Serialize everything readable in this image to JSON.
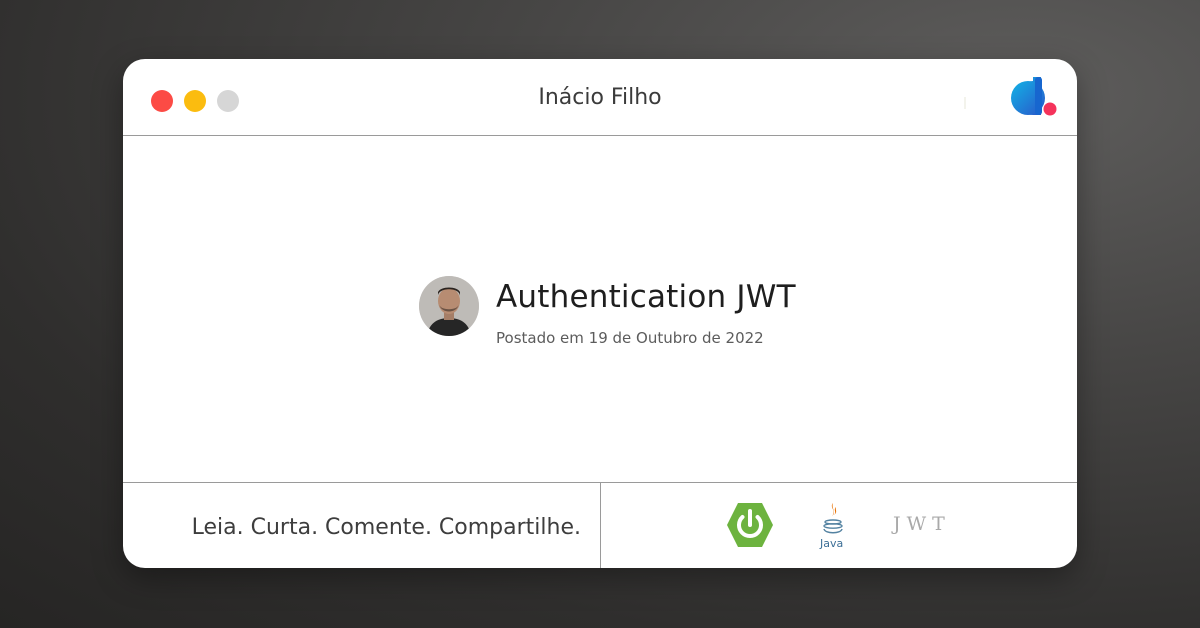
{
  "window": {
    "title": "Inácio Filho",
    "controls": [
      "close-dot",
      "minimize-dot",
      "maximize-dot"
    ],
    "brand_logo": "brand-logo-icon"
  },
  "post": {
    "title": "Authentication JWT",
    "date": "Postado em 19 de Outubro de 2022",
    "avatar": "avatar-icon"
  },
  "footer": {
    "tagline": "Leia. Curta. Comente. Compartilhe.",
    "tech_icons": [
      "spring-icon",
      "java-icon",
      "jwt-logo-icon"
    ],
    "jwt_label": "JWT",
    "java_label": "Java"
  },
  "colors": {
    "close": "#fc4b45",
    "minimize": "#fbbc0f",
    "maximize": "#d6d6d6",
    "brand_blue": "#1d88e0",
    "brand_accent": "#f5335b",
    "spring_green": "#6db33f"
  }
}
